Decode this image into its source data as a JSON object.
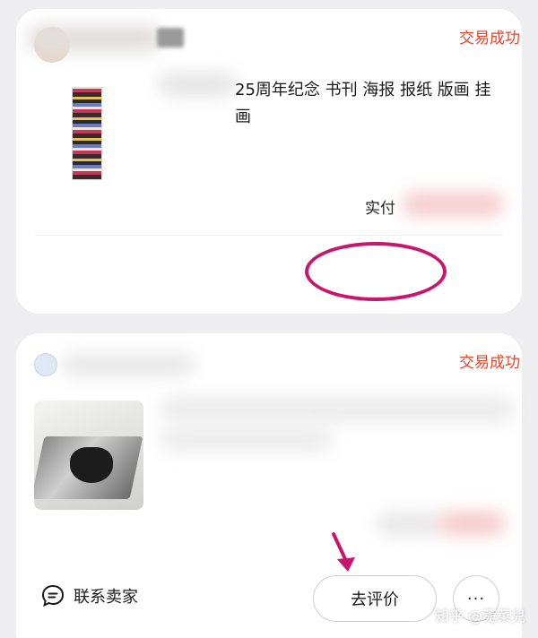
{
  "orders": [
    {
      "status": "交易成功",
      "title": "25周年纪念 书刊 海报 报纸 版画 挂画",
      "paid_label": "实付"
    },
    {
      "status": "交易成功"
    }
  ],
  "footer": {
    "contact_seller": "联系卖家",
    "review": "去评价",
    "more": "···"
  },
  "watermark": "知乎 @菀菜兒",
  "colors": {
    "status": "#e5452b",
    "annotation": "#c8166f",
    "background": "#eeeef0"
  }
}
